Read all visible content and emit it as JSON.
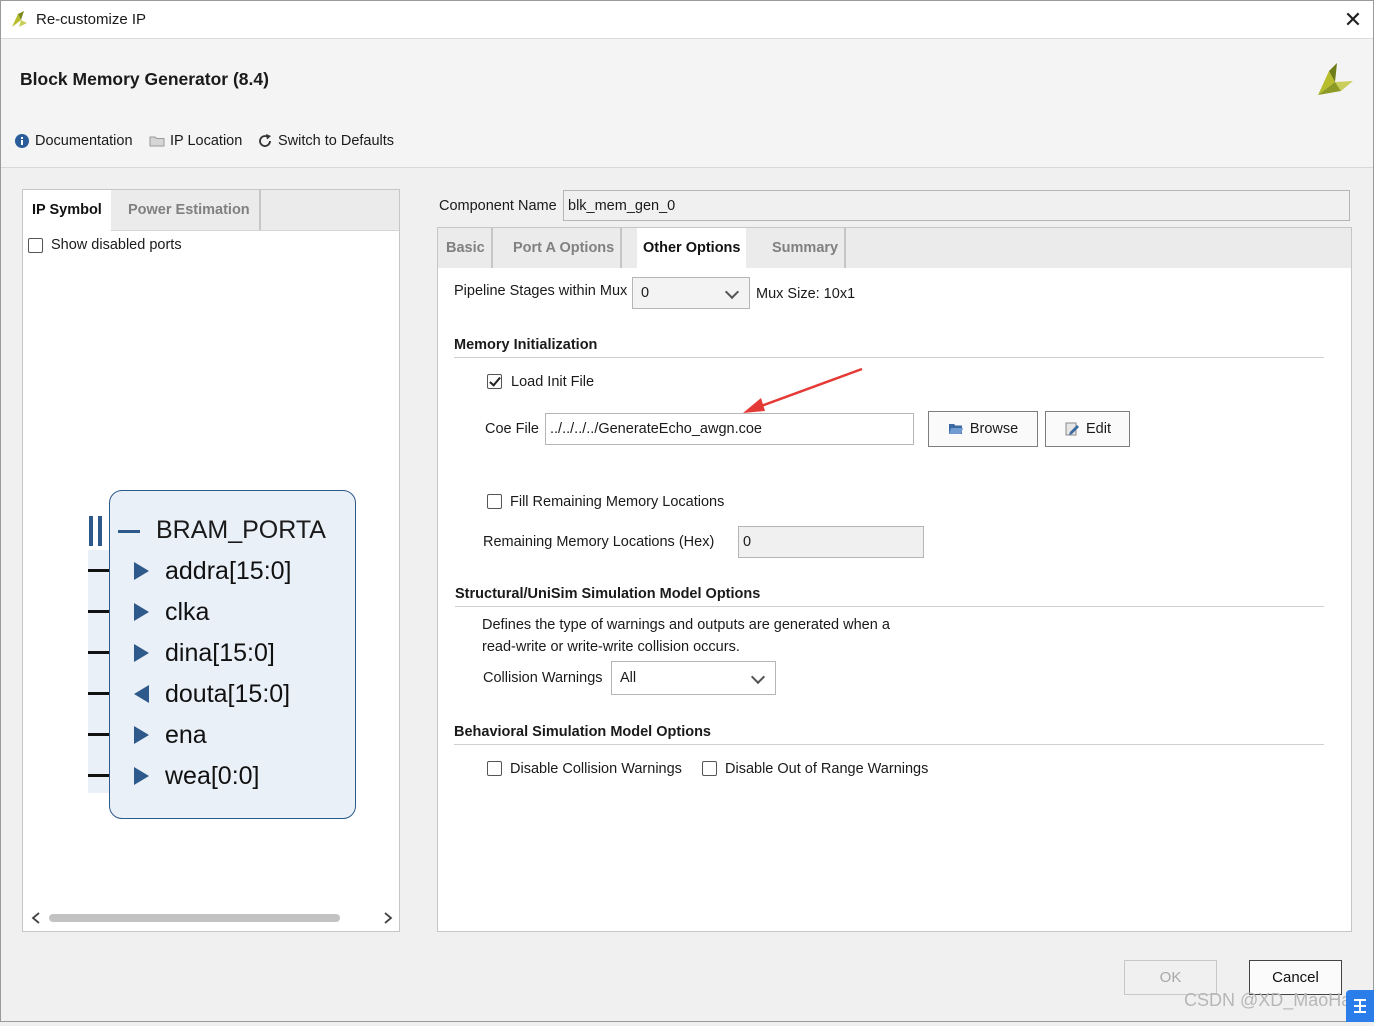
{
  "window": {
    "title": "Re-customize IP",
    "close_glyph": "✕"
  },
  "header": {
    "ip_title": "Block Memory Generator (8.4)",
    "logo_icon": "xilinx-logo-icon",
    "toolbar": [
      {
        "label": "Documentation",
        "icon": "info-icon"
      },
      {
        "label": "IP Location",
        "icon": "folder-icon"
      },
      {
        "label": "Switch to Defaults",
        "icon": "refresh-icon"
      }
    ]
  },
  "left_panel": {
    "tabs": [
      {
        "label": "IP Symbol",
        "active": true
      },
      {
        "label": "Power Estimation",
        "active": false
      }
    ],
    "show_disabled_ports": {
      "label": "Show disabled ports",
      "checked": false
    },
    "symbol": {
      "interface_name": "BRAM_PORTA",
      "collapse_glyph": "—",
      "ports": [
        {
          "name": "addra[15:0]",
          "direction": "in"
        },
        {
          "name": "clka",
          "direction": "in"
        },
        {
          "name": "dina[15:0]",
          "direction": "in"
        },
        {
          "name": "douta[15:0]",
          "direction": "out"
        },
        {
          "name": "ena",
          "direction": "in"
        },
        {
          "name": "wea[0:0]",
          "direction": "in"
        }
      ]
    }
  },
  "component": {
    "label": "Component Name",
    "value": "blk_mem_gen_0"
  },
  "right_tabs": [
    {
      "label": "Basic",
      "active": false
    },
    {
      "label": "Port A Options",
      "active": false
    },
    {
      "label": "Other Options",
      "active": true
    },
    {
      "label": "Summary",
      "active": false
    }
  ],
  "other_options": {
    "pipeline": {
      "label": "Pipeline Stages within Mux",
      "value": "0",
      "mux_size": "Mux Size: 10x1"
    },
    "memory_init": {
      "title": "Memory Initialization",
      "load_init_file": {
        "label": "Load Init File",
        "checked": true
      },
      "coe_file": {
        "label": "Coe File",
        "value": "../../../../GenerateEcho_awgn.coe"
      },
      "browse_label": "Browse",
      "edit_label": "Edit",
      "fill_remaining": {
        "label": "Fill Remaining Memory Locations",
        "checked": false
      },
      "remaining": {
        "label": "Remaining Memory Locations (Hex)",
        "value": "0"
      }
    },
    "structural": {
      "title": "Structural/UniSim Simulation Model Options",
      "description_line1": "Defines the type of warnings and outputs are generated when a",
      "description_line2": "read-write or write-write collision occurs.",
      "collision_warnings": {
        "label": "Collision Warnings",
        "value": "All"
      }
    },
    "behavioral": {
      "title": "Behavioral Simulation Model Options",
      "disable_collision": {
        "label": "Disable Collision Warnings",
        "checked": false
      },
      "disable_out_of_range": {
        "label": "Disable Out of Range Warnings",
        "checked": false
      }
    }
  },
  "footer": {
    "ok_label": "OK",
    "cancel_label": "Cancel",
    "watermark": "CSDN @XD_MaoHai"
  },
  "colors": {
    "accent_blue": "#2d5a8a",
    "arrow_red": "#e53935",
    "symbol_fill": "#eaf0f8"
  }
}
